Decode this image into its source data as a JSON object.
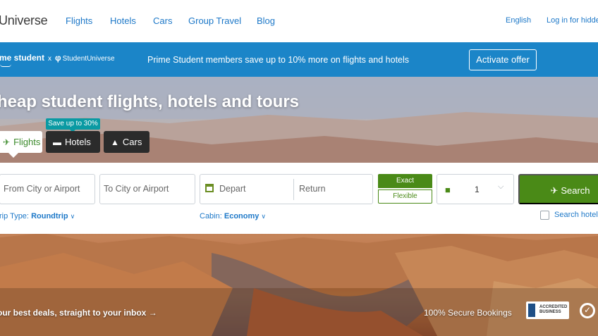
{
  "topnav": {
    "logo": "Universe",
    "links": [
      "Flights",
      "Hotels",
      "Cars",
      "Group Travel",
      "Blog"
    ],
    "language": "English",
    "login": "Log in for hidde"
  },
  "promo": {
    "prime_text": "me student",
    "x_sep": "x",
    "partner_logo": "StudentUniverse",
    "message": "Prime Student members save up to 10% more on flights and hotels",
    "cta": "Activate offer"
  },
  "hero": {
    "headline": "heap student flights, hotels and tours",
    "badge": "Save up to 30%",
    "tabs": [
      {
        "label": "Flights",
        "icon": "plane-icon",
        "active": true
      },
      {
        "label": "Hotels",
        "icon": "bed-icon",
        "active": false
      },
      {
        "label": "Cars",
        "icon": "car-icon",
        "active": false
      }
    ]
  },
  "search": {
    "from_placeholder": "From City or Airport",
    "to_placeholder": "To City or Airport",
    "depart_placeholder": "Depart",
    "return_placeholder": "Return",
    "exact": "Exact",
    "flexible": "Flexible",
    "passengers": "1",
    "button": "Search",
    "trip_type_label": "rip Type:",
    "trip_type_value": "Roundtrip",
    "cabin_label": "Cabin:",
    "cabin_value": "Economy",
    "search_hotels": "Search hotels"
  },
  "footer_strip": {
    "deals": "our best deals, straight to your inbox",
    "secure": "100% Secure Bookings",
    "bbb_text": "ACCREDITED BUSINESS"
  },
  "colors": {
    "brand_blue": "#1b85c8",
    "link_blue": "#1d78c8",
    "green": "#4a8a17",
    "teal_badge": "#0a9aa3"
  }
}
